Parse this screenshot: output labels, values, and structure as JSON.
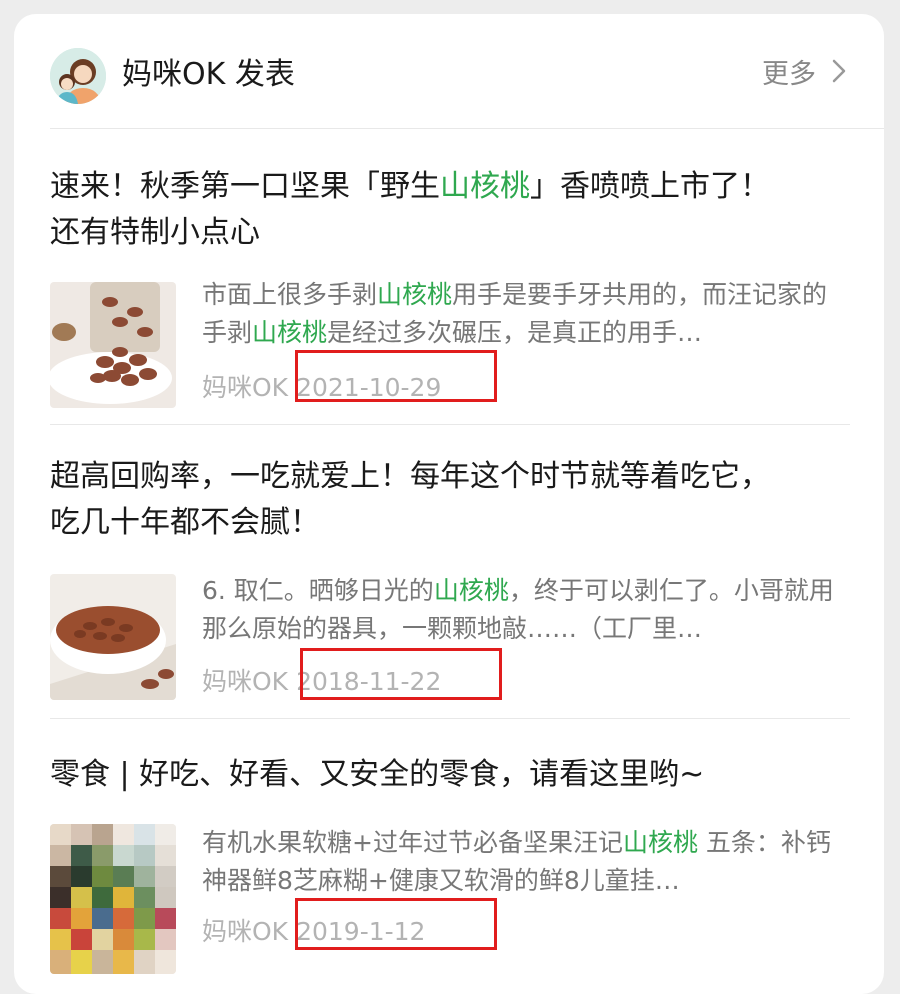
{
  "header": {
    "account_name": "妈咪OK 发表",
    "more_label": "更多",
    "avatar_icon": "family-avatar-icon"
  },
  "colors": {
    "keyword": "#2fa84f",
    "highlight_box": "#e11d1d"
  },
  "articles": [
    {
      "title_line1_pre": "速来！秋季第一口坚果「野生",
      "title_line1_kw": "山核桃",
      "title_line1_post": "」香喷喷上市了！",
      "title_line2": "还有特制小点心",
      "summary_a": "市面上很多手剥",
      "summary_kw1": "山核桃",
      "summary_b": "用手是要手牙共用的，而汪记家的手剥",
      "summary_kw2": "山核桃",
      "summary_c": "是经过多次碾压，是真正的用手…",
      "source": "妈咪OK",
      "date": "2021-10-29"
    },
    {
      "title_line1": "超高回购率，一吃就爱上！每年这个时节就等着吃它，",
      "title_line2": "吃几十年都不会腻！",
      "summary_a": "6. 取仁。晒够日光的",
      "summary_kw1": "山核桃",
      "summary_b": "，终于可以剥仁了。小哥就用那么原始的器具，一颗颗地敲……（工厂里…",
      "source": "妈咪OK",
      "date": "2018-11-22"
    },
    {
      "title_line1": "零食 | 好吃、好看、又安全的零食，请看这里哟~",
      "summary_a": "有机水果软糖+过年过节必备坚果汪记",
      "summary_kw1": "山核桃",
      "summary_b": " 五条：补钙神器鲜8芝麻糊+健康又软滑的鲜8儿童挂…",
      "source": "妈咪OK",
      "date": "2019-1-12"
    }
  ]
}
